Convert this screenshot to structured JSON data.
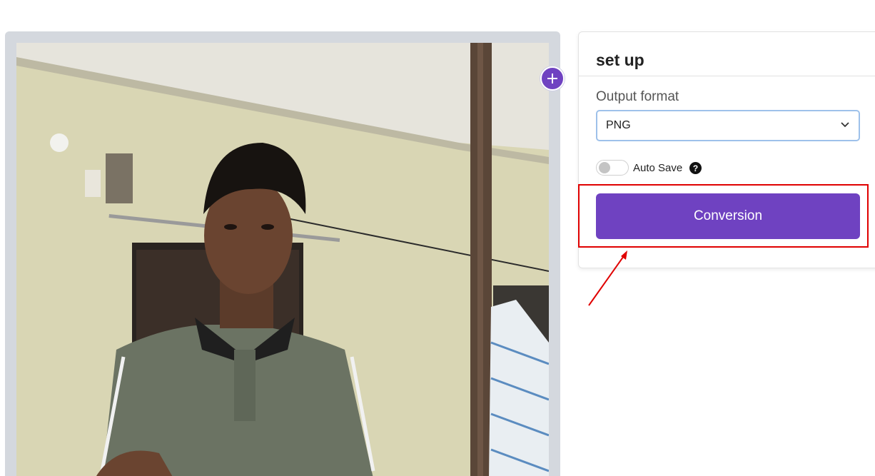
{
  "settings": {
    "title": "set up",
    "output_format_label": "Output format",
    "output_format_value": "PNG",
    "auto_save_label": "Auto Save",
    "auto_save_enabled": false,
    "help_glyph": "?",
    "convert_label": "Conversion"
  },
  "icons": {
    "add": "plus-icon",
    "dropdown": "chevron-down-icon",
    "help": "question-icon"
  },
  "colors": {
    "accent": "#6f42c1",
    "highlight": "#e00000",
    "select_border": "#9ec1ea",
    "preview_bg": "#d4d8de"
  }
}
